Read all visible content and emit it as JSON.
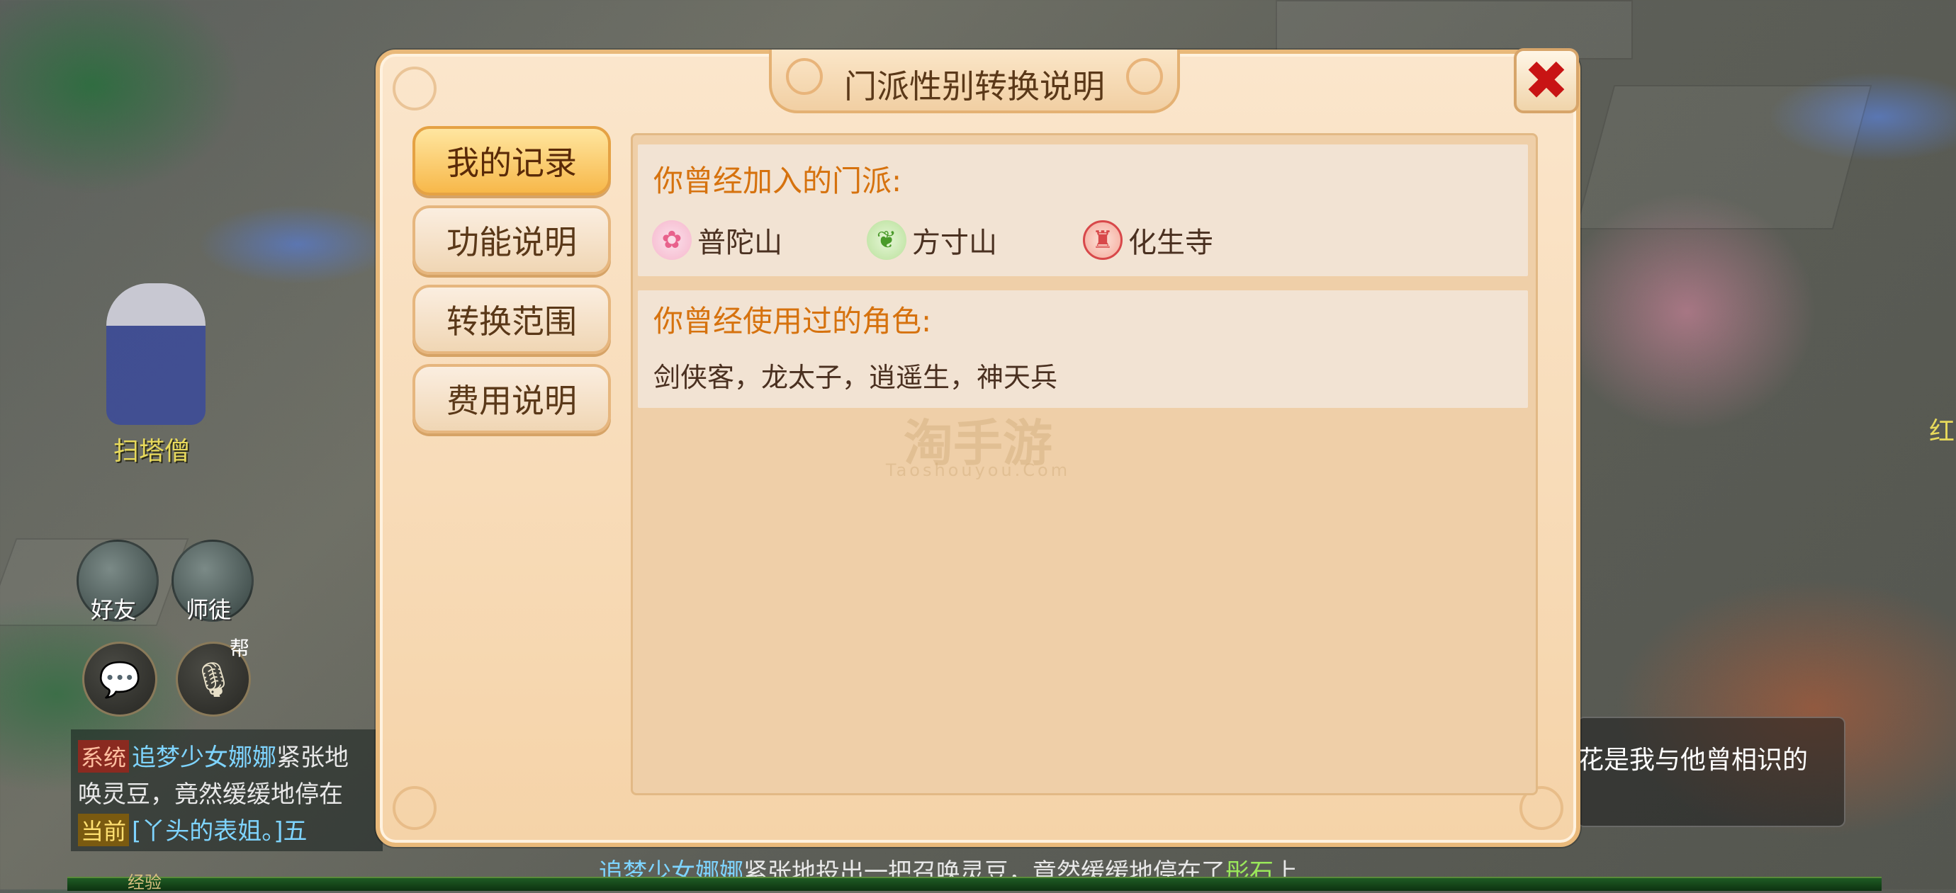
{
  "dialog": {
    "title": "门派性别转换说明",
    "close_symbol": "✖",
    "tabs": [
      {
        "label": "我的记录",
        "active": true
      },
      {
        "label": "功能说明",
        "active": false
      },
      {
        "label": "转换范围",
        "active": false
      },
      {
        "label": "费用说明",
        "active": false
      }
    ],
    "sects_heading": "你曾经加入的门派:",
    "sects": [
      {
        "name": "普陀山",
        "icon": "lotus-icon",
        "color": "#e8618c"
      },
      {
        "name": "方寸山",
        "icon": "leaf-icon",
        "color": "#5aa83a"
      },
      {
        "name": "化生寺",
        "icon": "pagoda-icon",
        "color": "#d8484a"
      }
    ],
    "roles_heading": "你曾经使用过的角色:",
    "roles_text": "剑侠客，龙太子，逍遥生，神天兵",
    "watermark": "淘手游",
    "watermark_sub": "Taoshouyou.Com"
  },
  "hud": {
    "npc_name": "扫塔僧",
    "friends_label": "好友",
    "master_label": "师徒",
    "voice_badge": "帮",
    "chat_icon": "chat-bubble-icon",
    "voice_icon": "microphone-icon"
  },
  "chat": {
    "line1_tag": "系统",
    "line1_name": "追梦少女娜娜",
    "line1_text": "紧张地",
    "line2_text": "唤灵豆，竟然缓缓地停在",
    "line3_tag": "当前",
    "line3_text": "[丫头的表姐。]五",
    "bottom_name": "追梦少女娜娜",
    "bottom_text": "紧张地投出一把召唤灵豆，竟然缓缓地停在了",
    "bottom_place": "彤石",
    "bottom_tail": "上",
    "exp_label": "经验"
  },
  "right": {
    "bubble_text": "花是我与他曾相识的",
    "npc_name_partial": "红"
  }
}
